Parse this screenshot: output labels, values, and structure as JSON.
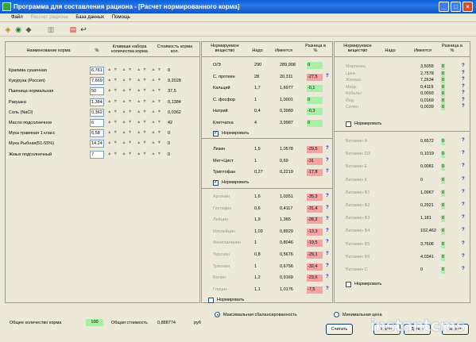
{
  "window": {
    "title": "Программа для составления рациона - [Расчет нормированного корма]"
  },
  "menu": {
    "items": [
      "Файл",
      "Рассчет рациона",
      "База данных",
      "Помощь"
    ]
  },
  "feeds": {
    "headers": {
      "name": "Наименование корма",
      "pct": "%",
      "keys": "Клавиши набора количества корма",
      "cost": "Стоимость корма кол."
    },
    "rows": [
      {
        "name": "Крапива сушенная",
        "pct": "6,761",
        "cost": "0"
      },
      {
        "name": "Кукуруза (Россия)",
        "pct": "7,669",
        "cost": "9,2028"
      },
      {
        "name": "Пшеница нормальная",
        "pct": "50",
        "cost": "37,5"
      },
      {
        "name": "Ракушка",
        "pct": "1,384",
        "cost": "0,1384"
      },
      {
        "name": "Соль (NaCl)",
        "pct": "0,362",
        "cost": "0,0362"
      },
      {
        "name": "Масло подсолнечное",
        "pct": "6",
        "cost": "42"
      },
      {
        "name": "Мука травяная 1 класс",
        "pct": "6,58",
        "cost": "0"
      },
      {
        "name": "Мука Рыбная(51-55%)",
        "pct": "14,24",
        "cost": "0"
      },
      {
        "name": "Жмых подсолнечный",
        "pct": "7",
        "cost": "0"
      }
    ],
    "total_label": "Общее количество корма",
    "total_value": "100",
    "cost_label": "Общая стоимость",
    "cost_value": "0,888774",
    "cost_unit": "руб"
  },
  "nutrients": {
    "headers": {
      "name": "Нормируемое вещество",
      "need": "Надо",
      "have": "Имеется",
      "diff": "Разница в %"
    },
    "main": [
      {
        "name": "О/Э",
        "need": "290",
        "have": "289,908",
        "diff": "0",
        "sign": "pos"
      },
      {
        "name": "С. протеин",
        "need": "28",
        "have": "20,311",
        "diff": "-27,5",
        "sign": "neg"
      },
      {
        "name": "Кальций",
        "need": "1,7",
        "have": "1,6977",
        "diff": "-0,1",
        "sign": "pos"
      },
      {
        "name": "С. фосфор",
        "need": "1",
        "have": "1,0001",
        "diff": "0",
        "sign": "pos"
      },
      {
        "name": "Натрий",
        "need": "0,4",
        "have": "0,3989",
        "diff": "-0,3",
        "sign": "pos"
      },
      {
        "name": "Клетчатка",
        "need": "4",
        "have": "3,9987",
        "diff": "0",
        "sign": "pos"
      }
    ],
    "main_check": "Нормировать",
    "amino1": [
      {
        "name": "Лизин",
        "need": "1,5",
        "have": "1,0578",
        "diff": "-29,5",
        "sign": "neg"
      },
      {
        "name": "Мет+Цист",
        "need": "1",
        "have": "0,69",
        "diff": "-31",
        "sign": "neg"
      },
      {
        "name": "Триптофан",
        "need": "0,27",
        "have": "0,2219",
        "diff": "-17,8",
        "sign": "neg"
      }
    ],
    "amino1_check": "Нормировать",
    "amino2": [
      {
        "name": "Аргинин",
        "need": "1,6",
        "have": "1,0351",
        "diff": "-35,3",
        "sign": "neg"
      },
      {
        "name": "Гистидин",
        "need": "0,6",
        "have": "0,4117",
        "diff": "-31,4",
        "sign": "neg"
      },
      {
        "name": "Лейцин",
        "need": "1,9",
        "have": "1,365",
        "diff": "-28,2",
        "sign": "neg"
      },
      {
        "name": "Изолейцин",
        "need": "1,03",
        "have": "0,8929",
        "diff": "-13,3",
        "sign": "neg"
      },
      {
        "name": "Фенилаланин",
        "need": "1",
        "have": "0,8046",
        "diff": "-19,5",
        "sign": "neg"
      },
      {
        "name": "Тирозин",
        "need": "0,8",
        "have": "0,5676",
        "diff": "-29,1",
        "sign": "neg"
      },
      {
        "name": "Треонин",
        "need": "1",
        "have": "0,6756",
        "diff": "-32,4",
        "sign": "neg"
      },
      {
        "name": "Валин",
        "need": "1,2",
        "have": "0,9169",
        "diff": "-23,6",
        "sign": "neg"
      },
      {
        "name": "Глицин",
        "need": "1,1",
        "have": "1,0176",
        "diff": "-7,5",
        "sign": "neg"
      }
    ],
    "amino2_check": "Нормировать"
  },
  "minerals": {
    "headers": {
      "name": "Нормируемое вещество",
      "need": "Надо",
      "have": "Имеется",
      "diff": "Разница в %"
    },
    "rows": [
      {
        "name": "Марганец",
        "have": "3,5055",
        "diff": "0"
      },
      {
        "name": "Цинк",
        "have": "2,7578",
        "diff": "0"
      },
      {
        "name": "Железо",
        "have": "7,2634",
        "diff": "0"
      },
      {
        "name": "Медь",
        "have": "0,4119",
        "diff": "0"
      },
      {
        "name": "Кобальт",
        "have": "0,0093",
        "diff": "0"
      },
      {
        "name": "Йод",
        "have": "0,0169",
        "diff": "0"
      },
      {
        "name": "Селен",
        "have": "0,0039",
        "diff": "0"
      }
    ],
    "check": "Нормировать"
  },
  "vitamins": {
    "rows": [
      {
        "name": "Витамин А",
        "have": "0,6572",
        "diff": "0"
      },
      {
        "name": "Витамин D3",
        "have": "0,1019",
        "diff": "0"
      },
      {
        "name": "Витамин Е",
        "have": "0,0081",
        "diff": "0"
      },
      {
        "name": "Витамин К",
        "have": "0",
        "diff": "0"
      },
      {
        "name": "Витамин В1",
        "have": "1,0967",
        "diff": "0"
      },
      {
        "name": "Витамин В2",
        "have": "0,2921",
        "diff": "0"
      },
      {
        "name": "Витамин В3",
        "have": "1,181",
        "diff": "0"
      },
      {
        "name": "Витамин В4",
        "have": "102,462",
        "diff": "0"
      },
      {
        "name": "Витамин В5",
        "have": "3,7606",
        "diff": "0"
      },
      {
        "name": "Витамин В6",
        "have": "4,0341",
        "diff": "0"
      },
      {
        "name": "Витамин С",
        "have": "0",
        "diff": "0"
      }
    ],
    "check": "Нормировать"
  },
  "bottom": {
    "radio_max": "Максимальная сбалансированность",
    "radio_min": "Минимальная цена",
    "buttons": [
      "Считать",
      "Назад",
      "Далее",
      "Закрыть"
    ]
  },
  "watermark": "instantcms",
  "colors": {
    "title": "#0a5fd8",
    "neg": "#f4a3a3",
    "pos": "#a8f0a8",
    "bg": "#ECE9D8"
  }
}
